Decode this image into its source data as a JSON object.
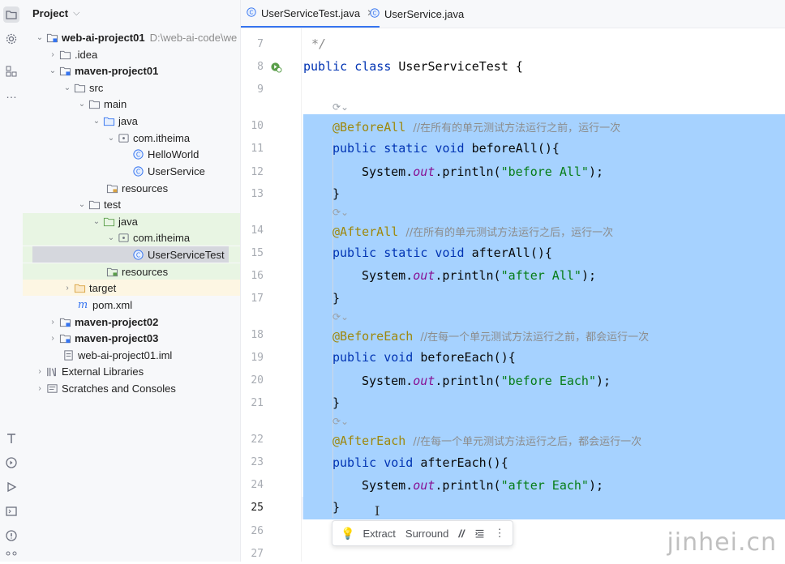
{
  "project_panel": {
    "title": "Project",
    "tree": [
      {
        "label": "web-ai-project01",
        "hint": "D:\\web-ai-code\\we",
        "bold": true
      },
      {
        "label": ".idea"
      },
      {
        "label": "maven-project01",
        "bold": true
      },
      {
        "label": "src"
      },
      {
        "label": "main"
      },
      {
        "label": "java"
      },
      {
        "label": "com.itheima"
      },
      {
        "label": "HelloWorld"
      },
      {
        "label": "UserService"
      },
      {
        "label": "resources"
      },
      {
        "label": "test"
      },
      {
        "label": "java"
      },
      {
        "label": "com.itheima"
      },
      {
        "label": "UserServiceTest"
      },
      {
        "label": "resources"
      },
      {
        "label": "target"
      },
      {
        "label": "pom.xml"
      },
      {
        "label": "maven-project02",
        "bold": true
      },
      {
        "label": "maven-project03",
        "bold": true
      },
      {
        "label": "web-ai-project01.iml"
      },
      {
        "label": "External Libraries"
      },
      {
        "label": "Scratches and Consoles"
      }
    ]
  },
  "tabs": [
    {
      "label": "UserServiceTest.java",
      "active": true
    },
    {
      "label": "UserService.java",
      "active": false
    }
  ],
  "line_numbers": [
    "7",
    "8",
    "9",
    "10",
    "11",
    "12",
    "13",
    "14",
    "15",
    "16",
    "17",
    "18",
    "19",
    "20",
    "21",
    "22",
    "23",
    "24",
    "25",
    "26",
    "27"
  ],
  "current_line": "25",
  "code": {
    "l7": "*/",
    "l8_kw": "public class ",
    "l8_name": "UserServiceTest {",
    "l10_anno": "@BeforeAll",
    "l10_cmt": "//在所有的单元测试方法运行之前，运行一次",
    "l11_kw": "public static void ",
    "l11_rest": "beforeAll(){",
    "l12_a": "System.",
    "l12_out": "out",
    "l12_b": ".println(",
    "l12_str": "\"before All\"",
    "l12_c": ");",
    "l13": "}",
    "l14_anno": "@AfterAll",
    "l14_cmt": "//在所有的单元测试方法运行之后，运行一次",
    "l15_kw": "public static void ",
    "l15_rest": "afterAll(){",
    "l16_a": "System.",
    "l16_out": "out",
    "l16_b": ".println(",
    "l16_str": "\"after All\"",
    "l16_c": ");",
    "l17": "}",
    "l18_anno": "@BeforeEach",
    "l18_cmt": "//在每一个单元测试方法运行之前，都会运行一次",
    "l19_kw": "public void ",
    "l19_rest": "beforeEach(){",
    "l20_a": "System.",
    "l20_out": "out",
    "l20_b": ".println(",
    "l20_str": "\"before Each\"",
    "l20_c": ");",
    "l21": "}",
    "l22_anno": "@AfterEach",
    "l22_cmt": "//在每一个单元测试方法运行之后，都会运行一次",
    "l23_kw": "public void ",
    "l23_rest": "afterEach(){",
    "l24_a": "System.",
    "l24_out": "out",
    "l24_b": ".println(",
    "l24_str": "\"after Each\"",
    "l24_c": ");",
    "l25": "}"
  },
  "popup": {
    "extract": "Extract",
    "surround": "Surround"
  },
  "watermark": "jinhei.cn",
  "colors": {
    "selection": "#a6d2ff",
    "accent": "#3574f0",
    "keyword": "#0033b3",
    "annotation": "#9e880d",
    "string": "#067d17"
  }
}
